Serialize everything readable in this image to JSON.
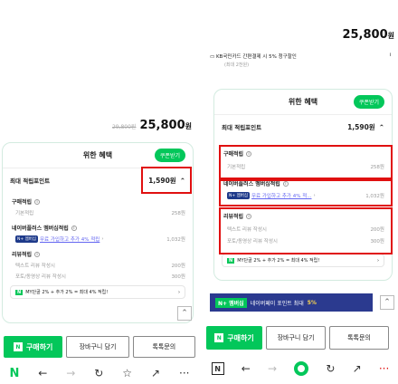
{
  "left": {
    "original_price": "29,800원",
    "final_price": "25,800",
    "final_price_unit": "원",
    "card_title": "위한 혜택",
    "coupon_button": "쿠폰받기",
    "max_points_label": "최대 적립포인트",
    "max_points_value": "1,590원",
    "purchase_title": "구매적립",
    "basic_label": "기본적립",
    "basic_value": "258원",
    "membership_title": "네이버플러스 멤버십적립",
    "membership_tag": "N+ 멤버십",
    "membership_link": "무료 가입하고 추가 4% 적립",
    "membership_value": "1,032원",
    "review_title": "리뷰적립",
    "text_review_label": "텍스트 리뷰 작성시",
    "text_review_value": "200원",
    "photo_review_label": "포토/동영상 리뷰 작성시",
    "photo_review_value": "300원",
    "promo_text": "MY단골 2% + 추가 2% = 최대 4% 적립!",
    "buy_label": "구매하기",
    "cart_label": "장바구니 담기",
    "inquiry_label": "톡톡문의"
  },
  "right": {
    "final_price": "25,800",
    "final_price_unit": "원",
    "kb_text": "KB국민카드 간편결제 시 5% 청구할인",
    "kb_sub": "(최대 2천원)",
    "card_title": "위한 혜택",
    "coupon_button": "쿠폰받기",
    "max_points_label": "최대 적립포인트",
    "max_points_value": "1,590원",
    "purchase_title": "구매적립",
    "basic_label": "기본적립",
    "basic_value": "258원",
    "membership_title": "네이버플러스 멤버십적립",
    "membership_tag": "N+ 멤버십",
    "membership_link": "무료 가입하고 추가 4% 적...",
    "membership_value": "1,032원",
    "review_title": "리뷰적립",
    "text_review_label": "텍스트 리뷰 작성시",
    "text_review_value": "200원",
    "photo_review_label": "포토/동영상 리뷰 작성시",
    "photo_review_value": "300원",
    "promo_text": "MY단골 2% + 추가 2% = 최대 4% 적립!",
    "banner_tag": "N+ 멤버십",
    "banner_text": "네이버페이 포인트 최대",
    "banner_highlight": "5%",
    "buy_label": "구매하기",
    "cart_label": "장바구니 담기",
    "inquiry_label": "톡톡문의"
  },
  "colors": {
    "naver_green": "#03c75a",
    "highlight_red": "#e01010",
    "banner_navy": "#2b3a8f"
  },
  "icons": [
    "naver-n-icon",
    "back-arrow-icon",
    "forward-arrow-icon",
    "refresh-icon",
    "star-icon",
    "share-icon",
    "more-icon",
    "info-icon",
    "chevron-up-icon",
    "chevron-right-icon",
    "card-icon",
    "scroll-top-icon"
  ]
}
